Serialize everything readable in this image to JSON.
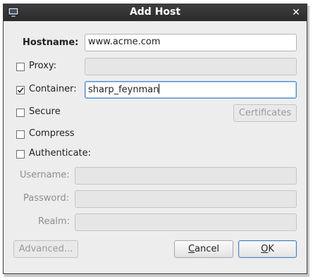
{
  "window": {
    "title": "Add Host"
  },
  "form": {
    "hostname": {
      "label": "Hostname:",
      "value": "www.acme.com"
    },
    "proxy": {
      "label": "Proxy:",
      "checked": false,
      "value": ""
    },
    "container": {
      "label": "Container:",
      "checked": true,
      "value": "sharp_feynman"
    },
    "secure": {
      "label": "Secure",
      "checked": false
    },
    "certificates_label": "Certificates",
    "compress": {
      "label": "Compress",
      "checked": false
    },
    "authenticate": {
      "label": "Authenticate:",
      "checked": false
    },
    "username": {
      "label": "Username:",
      "value": ""
    },
    "password": {
      "label": "Password:",
      "value": ""
    },
    "realm": {
      "label": "Realm:",
      "value": ""
    }
  },
  "buttons": {
    "advanced": "Advanced...",
    "cancel_first": "C",
    "cancel_rest": "ancel",
    "ok_first": "O",
    "ok_rest": "K"
  },
  "icons": {
    "app": "monitor-icon",
    "close": "close-icon"
  }
}
